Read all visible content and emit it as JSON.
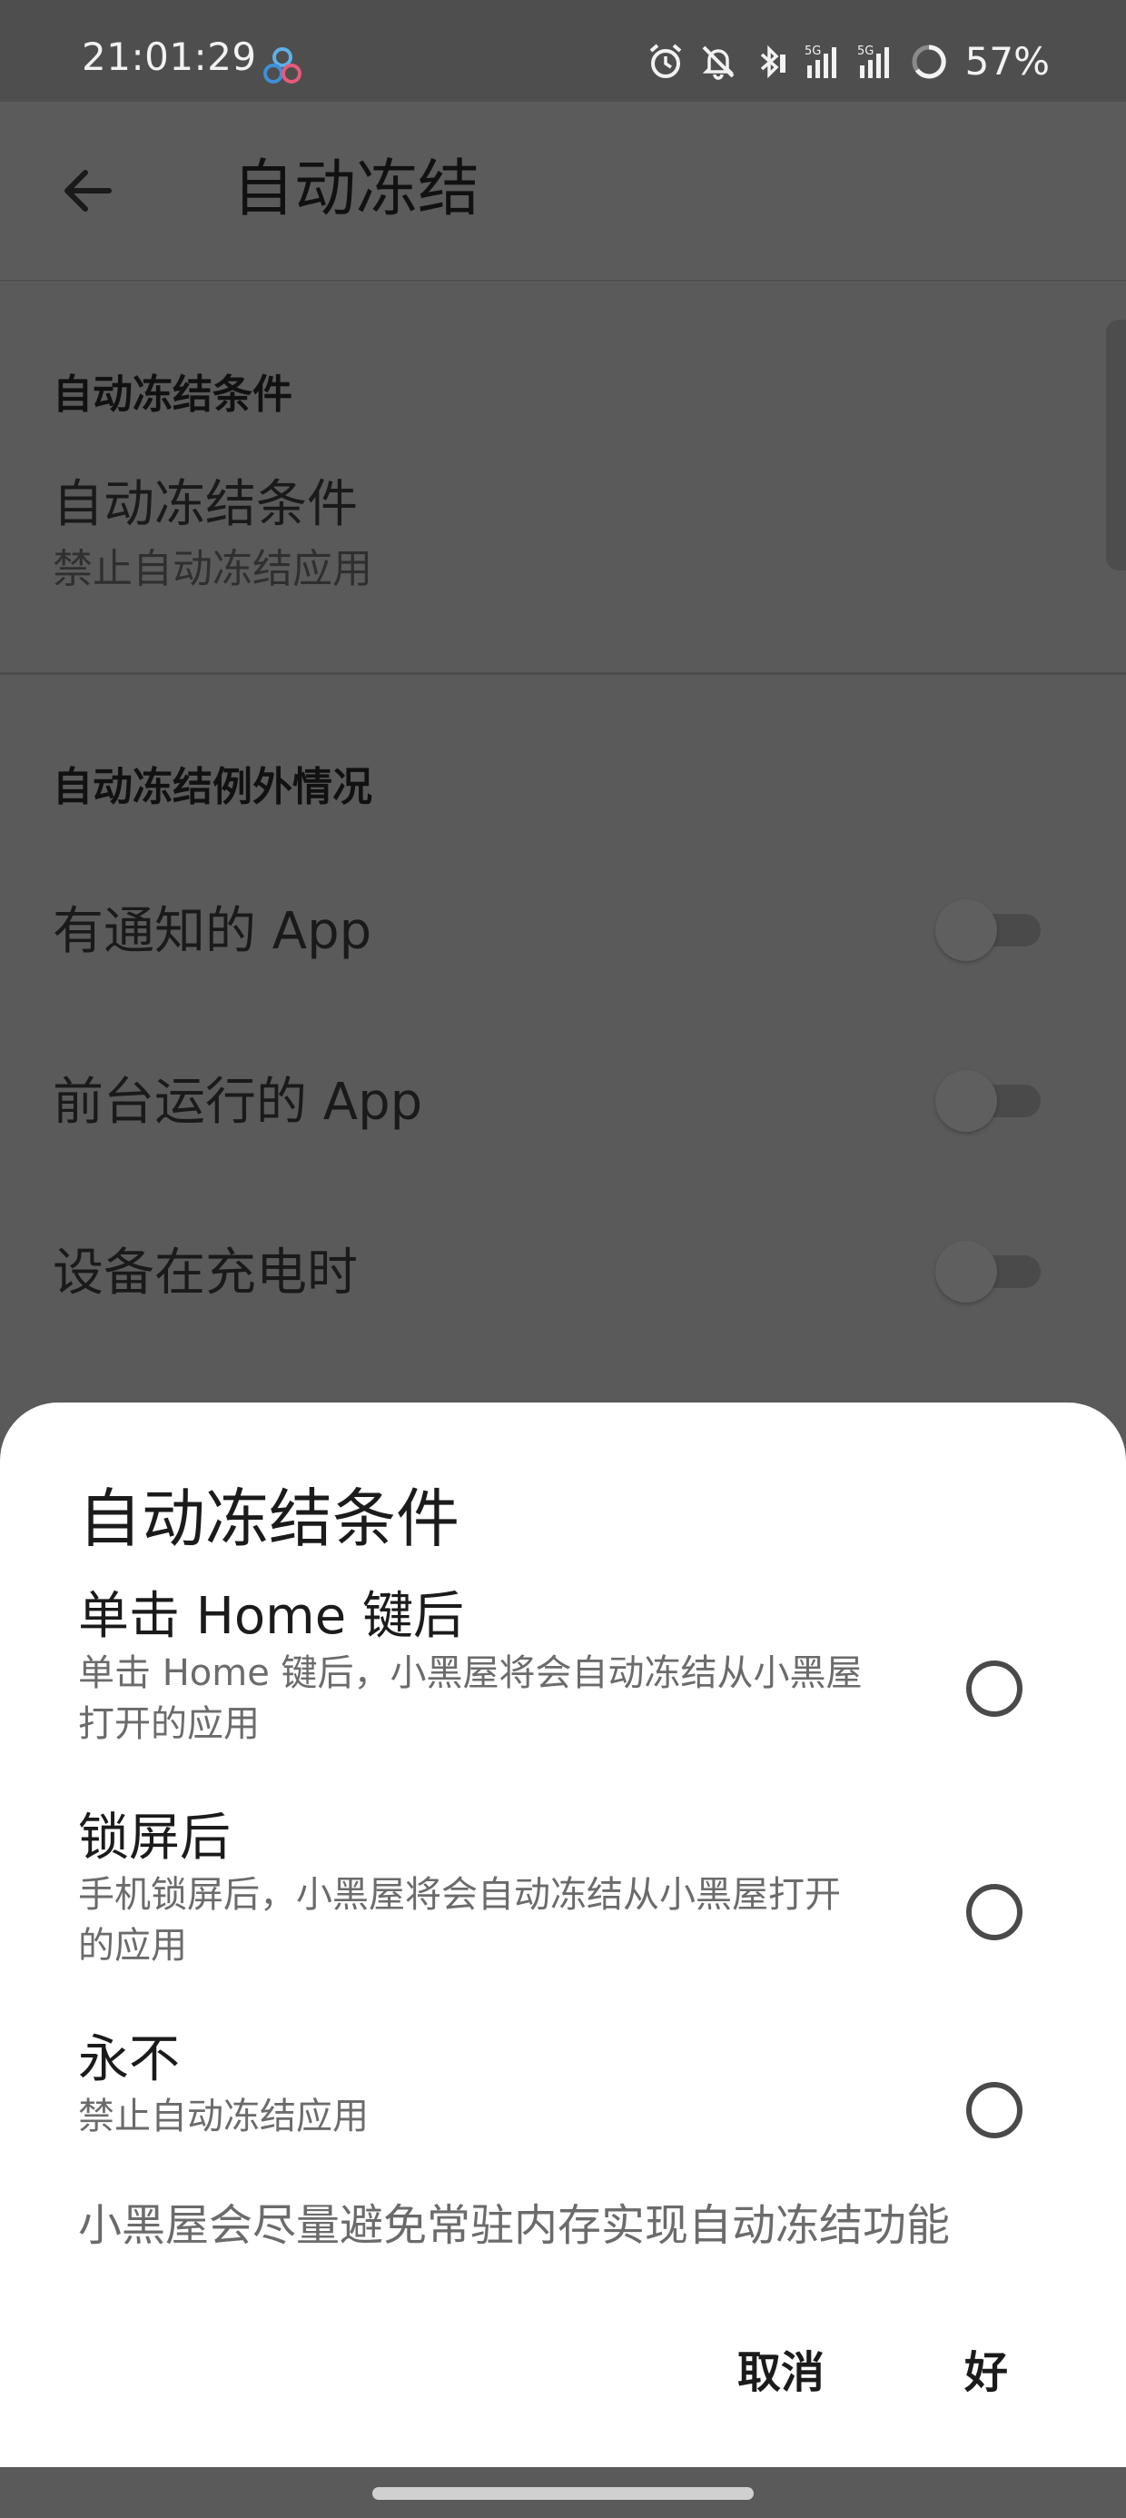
{
  "status_bar": {
    "time": "21:01:29",
    "battery_percent": "57%",
    "icons": [
      "app-notification-icon",
      "alarm-icon",
      "mute-icon",
      "bluetooth-icon",
      "signal-5g-icon",
      "signal-5g-icon",
      "battery-ring-icon"
    ],
    "network_labels": [
      "5G",
      "5G"
    ]
  },
  "app_bar": {
    "title": "自动冻结"
  },
  "settings": {
    "section1_header": "自动冻结条件",
    "condition_title": "自动冻结条件",
    "condition_summary": "禁止自动冻结应用",
    "section2_header": "自动冻结例外情况",
    "exceptions": [
      {
        "label": "有通知的 App",
        "enabled": false
      },
      {
        "label": "前台运行的 App",
        "enabled": false
      },
      {
        "label": "设备在充电时",
        "enabled": false
      }
    ]
  },
  "dialog": {
    "title": "自动冻结条件",
    "options": [
      {
        "title": "单击 Home 键后",
        "description_lines": [
          "单击 Home 键后，小黑屋将会自动冻结从小黑屋",
          "打开的应用"
        ],
        "selected": false
      },
      {
        "title": "锁屏后",
        "description_lines": [
          "手机锁屏后，小黑屋将会自动冻结从小黑屋打开",
          "的应用"
        ],
        "selected": false
      },
      {
        "title": "永不",
        "description_lines": [
          "禁止自动冻结应用"
        ],
        "selected": false
      }
    ],
    "note": "小黑屋会尽量避免常驻内存实现自动冻结功能",
    "cancel_label": "取消",
    "ok_label": "好"
  },
  "colors": {
    "scrim_background": "#5a5a5a",
    "sheet_background": "#ffffff",
    "primary_text": "#1b1b1b",
    "secondary_text": "#6b6b6b"
  }
}
